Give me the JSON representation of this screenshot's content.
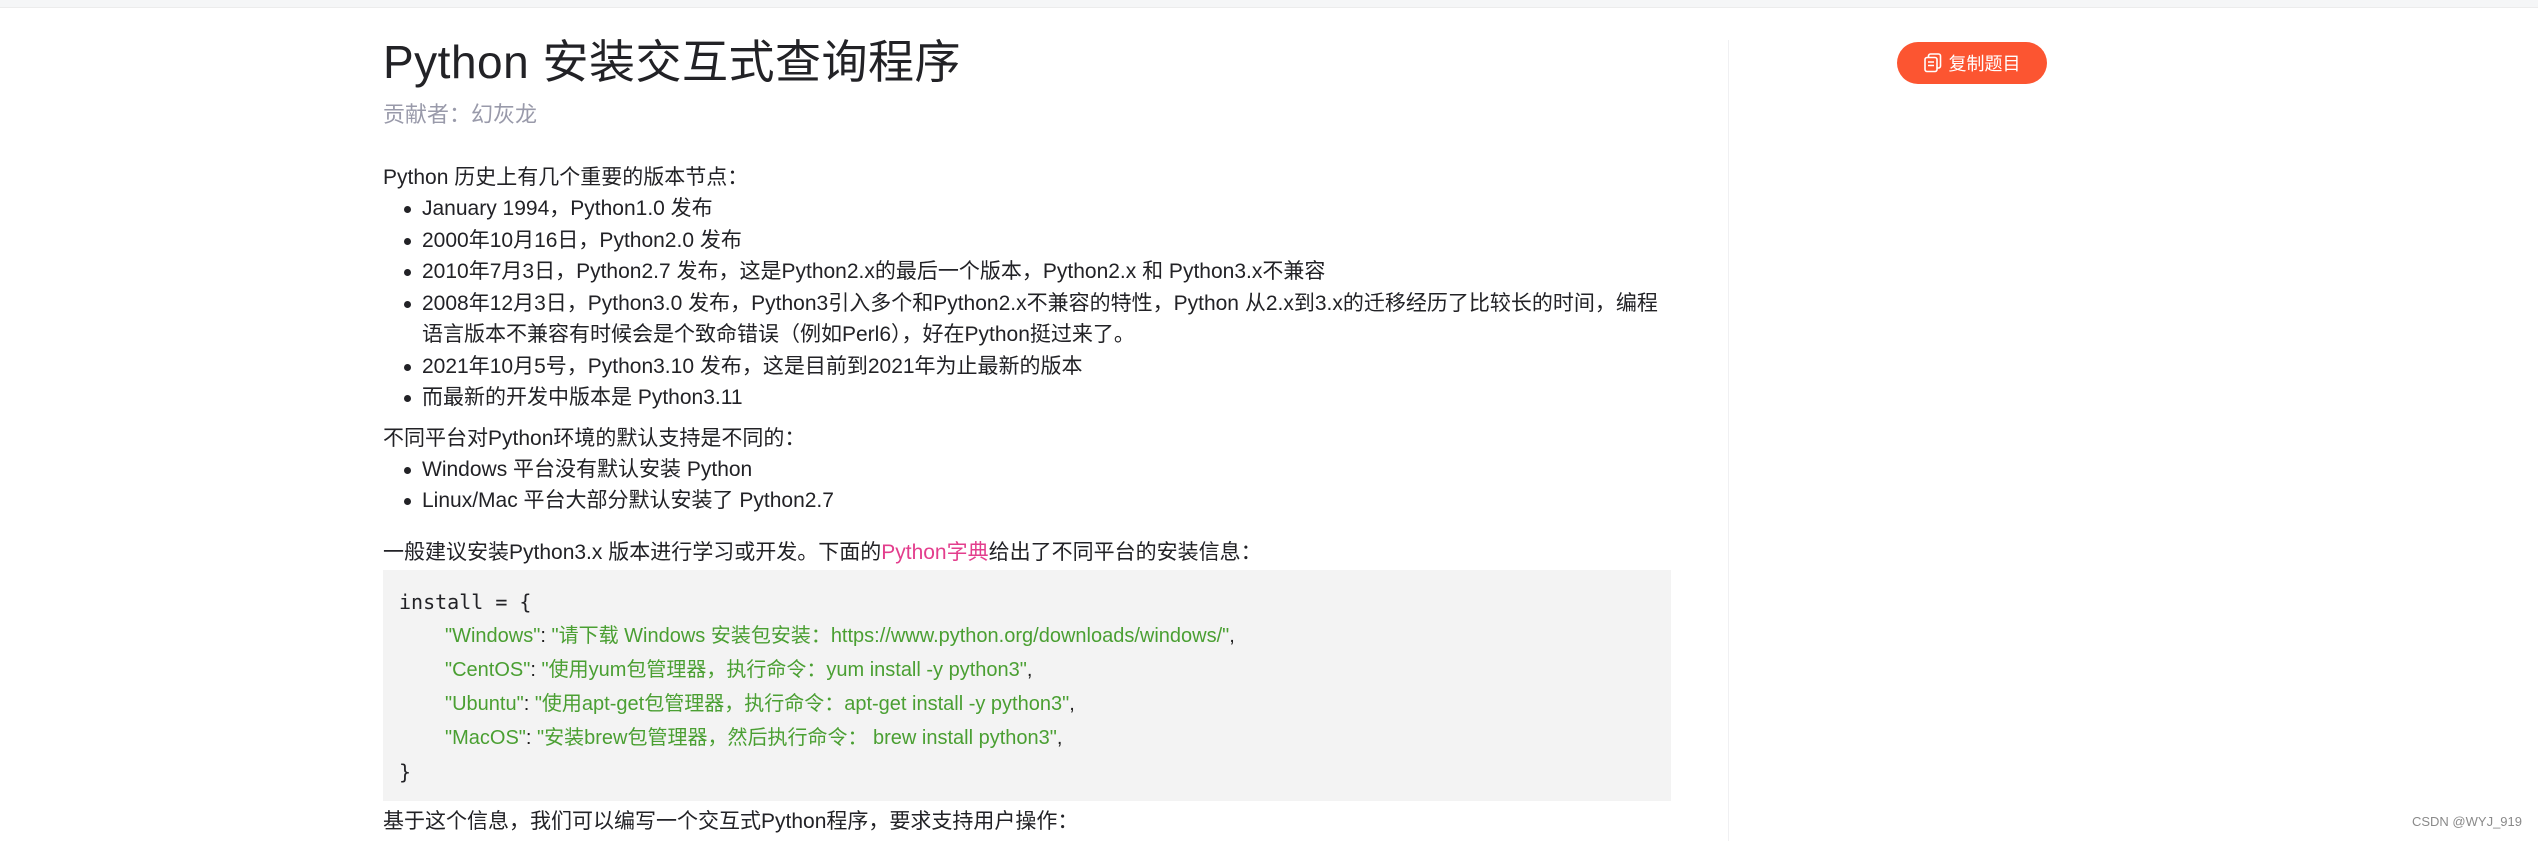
{
  "page": {
    "title": "Python 安装交互式查询程序",
    "contributor": "贡献者：幻灰龙"
  },
  "article": {
    "intro": "Python 历史上有几个重要的版本节点：",
    "history": [
      "January 1994，Python1.0 发布",
      "2000年10月16日，Python2.0 发布",
      "2010年7月3日，Python2.7 发布，这是Python2.x的最后一个版本，Python2.x 和 Python3.x不兼容",
      "2008年12月3日，Python3.0 发布，Python3引入多个和Python2.x不兼容的特性，Python 从2.x到3.x的迁移经历了比较长的时间，编程语言版本不兼容有时候会是个致命错误（例如Perl6），好在Python挺过来了。",
      "2021年10月5号，Python3.10 发布，这是目前到2021年为止最新的版本",
      "而最新的开发中版本是 Python3.11"
    ],
    "platform_intro": "不同平台对Python环境的默认支持是不同的：",
    "platforms": [
      "Windows 平台没有默认安装 Python",
      "Linux/Mac 平台大部分默认安装了 Python2.7"
    ],
    "suggest_before": "一般建议安装Python3.x 版本进行学习或开发。下面的",
    "suggest_link": "Python字典",
    "suggest_after": "给出了不同平台的安装信息：",
    "code": {
      "open": "install = {",
      "entries": [
        {
          "key": "\"Windows\"",
          "sep": ": ",
          "value": "\"请下载 Windows 安装包安装：https://www.python.org/downloads/windows/\"",
          "tail": ","
        },
        {
          "key": "\"CentOS\"",
          "sep": ": ",
          "value": "\"使用yum包管理器，执行命令：yum install -y python3\"",
          "tail": ","
        },
        {
          "key": "\"Ubuntu\"",
          "sep": ": ",
          "value": "\"使用apt-get包管理器，执行命令：apt-get install -y python3\"",
          "tail": ","
        },
        {
          "key": "\"MacOS\"",
          "sep": ": ",
          "value": "\"安装brew包管理器，然后执行命令： brew install python3\"",
          "tail": ","
        }
      ],
      "close": "}"
    },
    "outro": "基于这个信息，我们可以编写一个交互式Python程序，要求支持用户操作："
  },
  "sidebar": {
    "copy_button_label": "复制题目",
    "copy_button_icon": "copy-icon",
    "accent_color": "#fc5531"
  },
  "watermark": "CSDN @WYJ_919",
  "colors": {
    "link": "#e33e8d",
    "code_string": "#4a9f32",
    "code_bg": "#f3f3f3"
  }
}
